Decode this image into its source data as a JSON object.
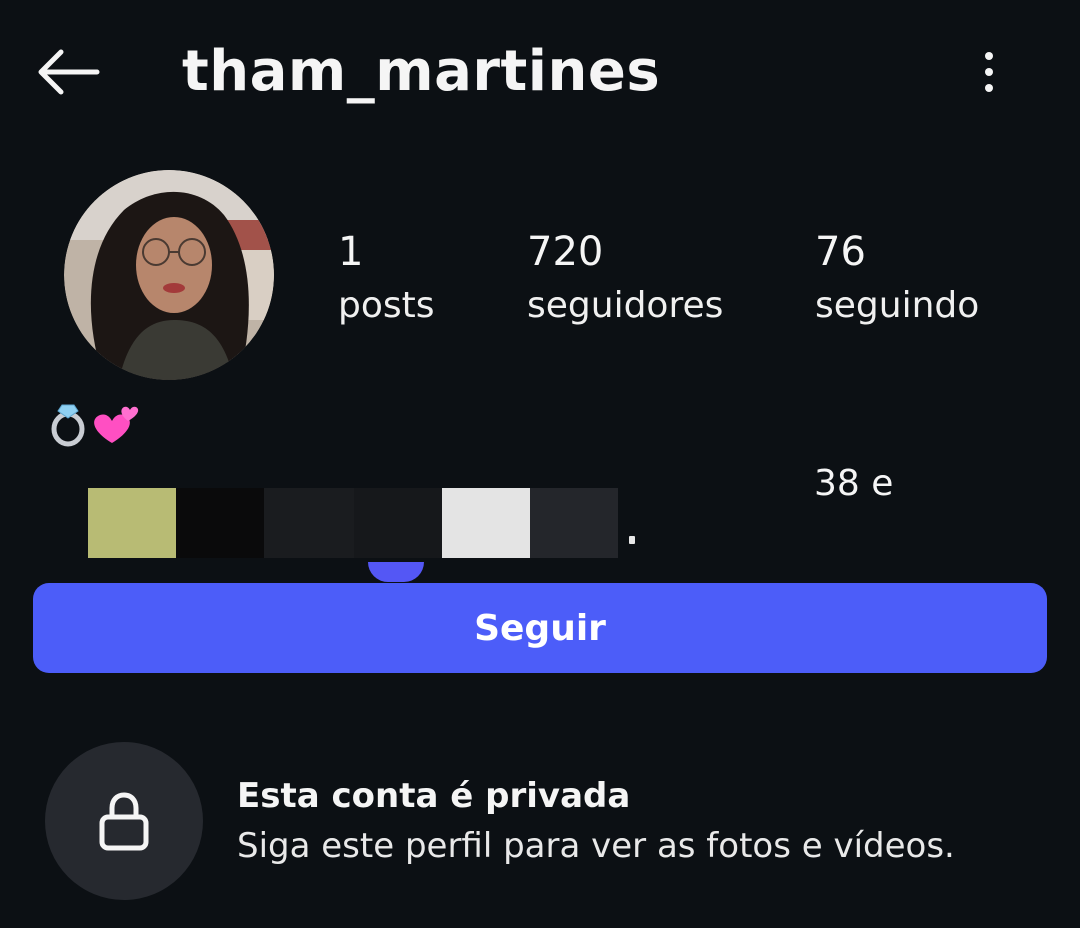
{
  "header": {
    "username": "tham_martines",
    "back_icon": "arrow-left-icon",
    "more_icon": "more-vertical-icon"
  },
  "profile": {
    "avatar_icon": "profile-photo",
    "stats": [
      {
        "value": "1",
        "label": "posts"
      },
      {
        "value": "720",
        "label": "seguidores"
      },
      {
        "value": "76",
        "label": "seguindo"
      }
    ]
  },
  "bio": {
    "emoji": "💍💕",
    "visible_fragment": "38 e"
  },
  "actions": {
    "follow_label": "Seguir"
  },
  "private": {
    "title": "Esta conta é privada",
    "subtitle": "Siga este perfil para ver as fotos e vídeos.",
    "lock_icon": "lock-icon"
  },
  "colors": {
    "background": "#0c1014",
    "follow_button": "#4c5df9",
    "lock_circle": "#26292f"
  }
}
